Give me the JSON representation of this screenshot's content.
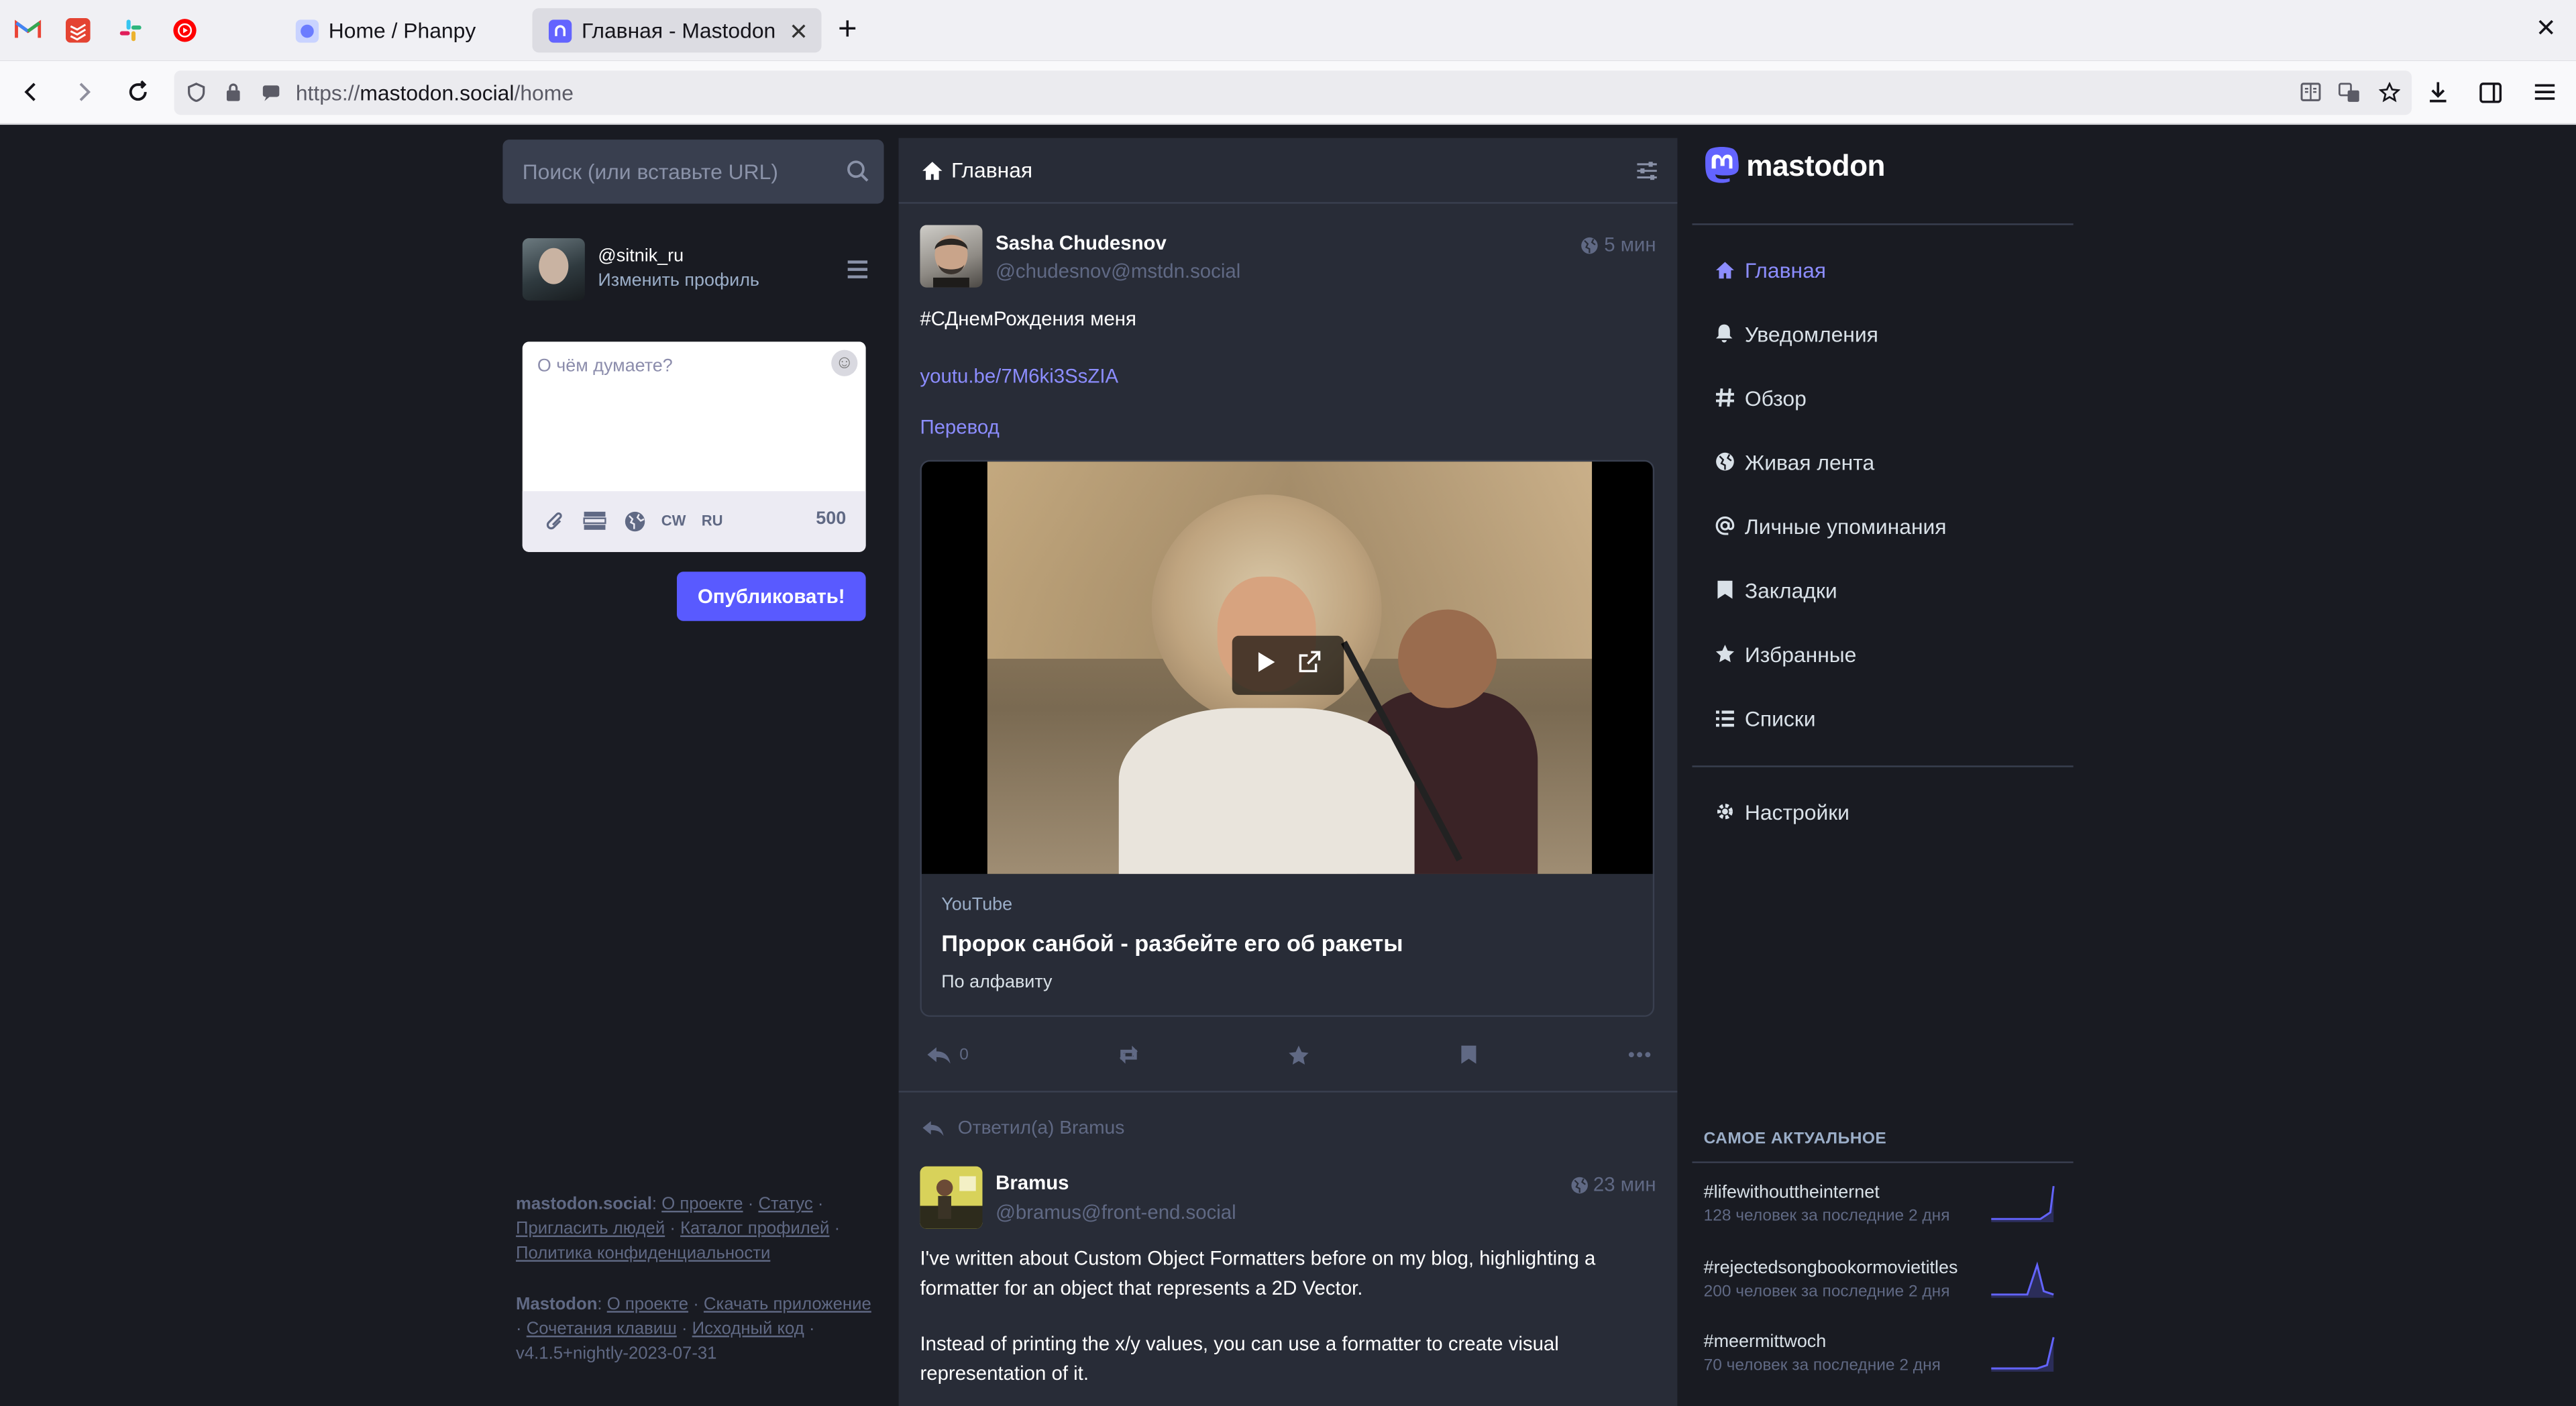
{
  "browser": {
    "tabs": [
      {
        "title": "Home / Phanpy"
      },
      {
        "title": "Главная - Mastodon"
      }
    ],
    "url_prefix": "https://",
    "url_host": "mastodon.social",
    "url_path": "/home"
  },
  "search": {
    "placeholder": "Поиск (или вставьте URL)"
  },
  "me": {
    "handle": "@sitnik_ru",
    "edit_profile": "Изменить профиль"
  },
  "compose": {
    "placeholder": "О чём думаете?",
    "cw": "CW",
    "lang": "RU",
    "counter": "500",
    "publish": "Опубликовать!"
  },
  "column": {
    "title": "Главная"
  },
  "post1": {
    "name": "Sasha Chudesnov",
    "acct": "@chudesnov@mstdn.social",
    "time": "5 мин",
    "text": "#СДнемРождения меня",
    "link": "youtu.be/7M6ki3SsZIA",
    "translate": "Перевод",
    "card": {
      "provider": "YouTube",
      "title": "Пророк санбой - разбейте его об ракеты",
      "description": "По алфавиту"
    },
    "reply_count": "0"
  },
  "post2": {
    "replied_to": "Ответил(а) Bramus",
    "name": "Bramus",
    "acct": "@bramus@front-end.social",
    "time": "23 мин",
    "para1_line1": "I've written about Custom Object Formatters before on my blog, highlighting a",
    "para1_line2": "formatter for an object that represents a 2D Vector.",
    "para2_line1": "Instead of printing the x/y values, you can use a formatter to create visual",
    "para2_line2": "representation of it."
  },
  "nav": {
    "logo": "mastodon",
    "items": [
      {
        "label": "Главная",
        "icon": "home-icon"
      },
      {
        "label": "Уведомления",
        "icon": "bell-icon"
      },
      {
        "label": "Обзор",
        "icon": "hashtag-icon"
      },
      {
        "label": "Живая лента",
        "icon": "globe-icon"
      },
      {
        "label": "Личные упоминания",
        "icon": "at-icon"
      },
      {
        "label": "Закладки",
        "icon": "bookmark-icon"
      },
      {
        "label": "Избранные",
        "icon": "star-icon"
      },
      {
        "label": "Списки",
        "icon": "list-icon"
      },
      {
        "label": "Настройки",
        "icon": "gear-icon"
      }
    ]
  },
  "trends": {
    "heading": "САМОЕ АКТУАЛЬНОЕ",
    "items": [
      {
        "tag": "#lifewithouttheinternet",
        "count": "128 человек за последние 2 дня"
      },
      {
        "tag": "#rejectedsongbookormovietitles",
        "count": "200 человек за последние 2 дня"
      },
      {
        "tag": "#meermittwoch",
        "count": "70 человек за последние 2 дня"
      }
    ]
  },
  "footer": {
    "server": "mastodon.social",
    "about": "О проекте",
    "status": "Статус",
    "invite": "Пригласить людей",
    "directory": "Каталог профилей",
    "privacy": "Политика конфиденциальности",
    "mastodon": "Mastodon",
    "m_about": "О проекте",
    "download": "Скачать приложение",
    "shortcuts": "Сочетания клавиш",
    "source": "Исходный код",
    "version": "v4.1.5+nightly-2023-07-31"
  },
  "colors": {
    "accent": "#8c8dff",
    "button": "#595aff",
    "bg": "#191b22",
    "column": "#282c37"
  }
}
